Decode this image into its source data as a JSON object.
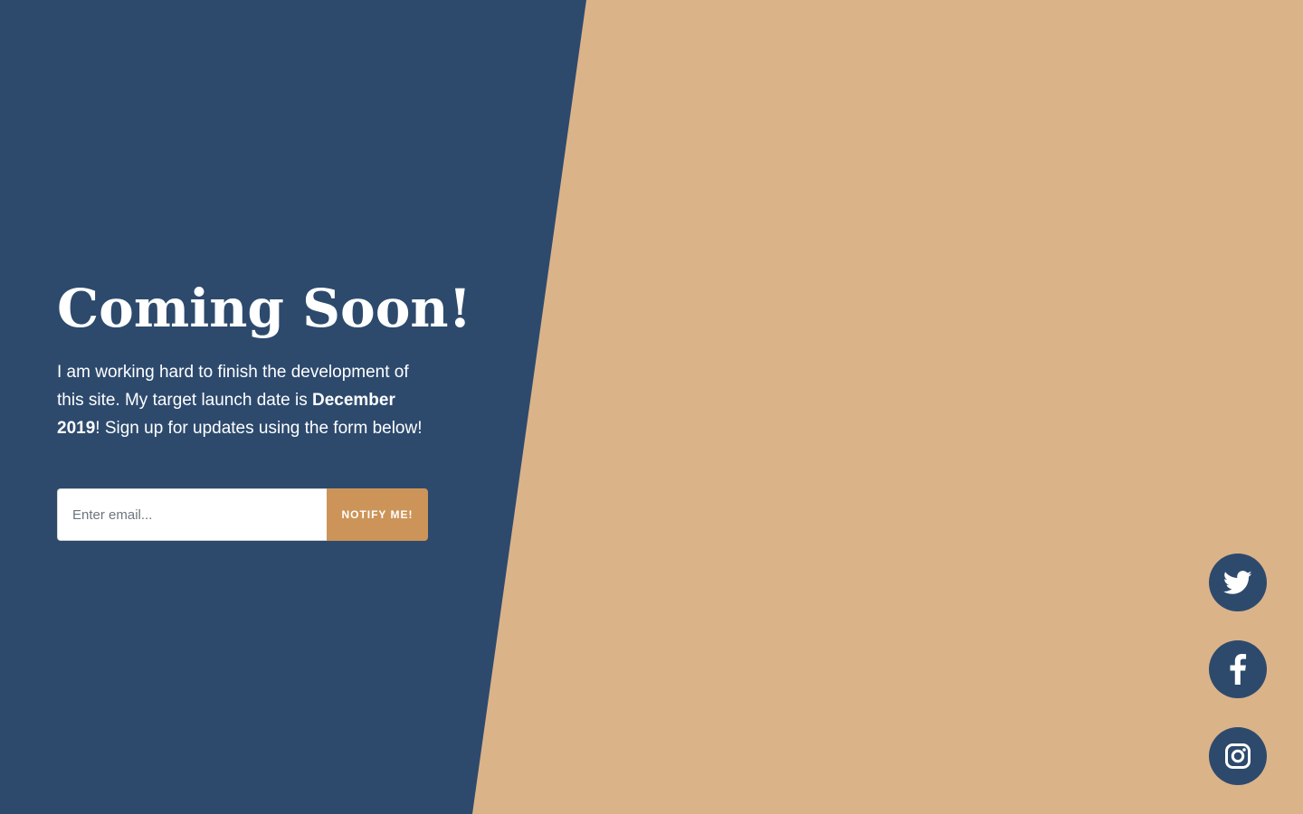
{
  "colors": {
    "left_panel": "#2d4a6d",
    "right_panel": "#dbb389",
    "button": "#cc9458",
    "social_circle": "#2d4a6d"
  },
  "hero": {
    "title": "Coming Soon!",
    "lead_part1": "I am working hard to finish the development of this site. My target launch date is ",
    "lead_bold": "December 2019",
    "lead_part2": "! Sign up for updates using the form below!"
  },
  "signup_form": {
    "email_placeholder": "Enter email...",
    "email_value": "",
    "submit_label": "NOTIFY ME!"
  },
  "social_links": [
    {
      "icon": "twitter-icon"
    },
    {
      "icon": "facebook-icon"
    },
    {
      "icon": "instagram-icon"
    }
  ]
}
